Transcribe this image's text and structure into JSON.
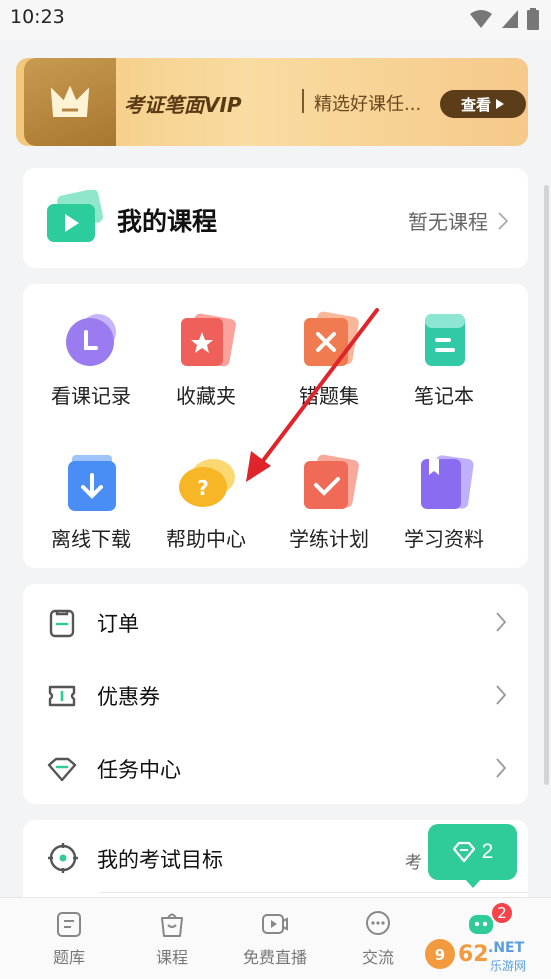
{
  "status": {
    "time": "10:23"
  },
  "vip": {
    "title": "考证笔面VIP",
    "subtitle": "精选好课任...",
    "button": "查看"
  },
  "my_course": {
    "title": "我的课程",
    "status": "暂无课程"
  },
  "grid": [
    {
      "label": "看课记录",
      "icon": "history-clock-icon",
      "color": "#9b7cf0"
    },
    {
      "label": "收藏夹",
      "icon": "favorites-star-icon",
      "color": "#f0605a"
    },
    {
      "label": "错题集",
      "icon": "wrong-questions-icon",
      "color": "#f07b50"
    },
    {
      "label": "笔记本",
      "icon": "notebook-icon",
      "color": "#31c9a6"
    },
    {
      "label": "离线下载",
      "icon": "offline-download-icon",
      "color": "#4a8df5"
    },
    {
      "label": "帮助中心",
      "icon": "help-question-icon",
      "color": "#f6b625"
    },
    {
      "label": "学练计划",
      "icon": "study-plan-check-icon",
      "color": "#f06a58"
    },
    {
      "label": "学习资料",
      "icon": "study-materials-icon",
      "color": "#8a6cf0"
    }
  ],
  "menu": [
    {
      "label": "订单",
      "icon": "order-clipboard-icon"
    },
    {
      "label": "优惠券",
      "icon": "coupon-ticket-icon"
    },
    {
      "label": "任务中心",
      "icon": "task-diamond-icon"
    }
  ],
  "goal": {
    "label": "我的考试目标",
    "right": "考"
  },
  "float_button": {
    "count": "2"
  },
  "tabs": [
    {
      "label": "题库",
      "icon": "question-bank-icon"
    },
    {
      "label": "课程",
      "icon": "course-bag-icon"
    },
    {
      "label": "免费直播",
      "icon": "live-video-icon"
    },
    {
      "label": "交流",
      "icon": "chat-bubble-icon"
    },
    {
      "label": "",
      "icon": "profile-robot-icon"
    }
  ],
  "tab_badge": "2",
  "colors": {
    "accent": "#2fcc9a",
    "vip_dark": "#5b3d1a",
    "badge": "#f5454a",
    "annotation_arrow": "#e0242b"
  }
}
